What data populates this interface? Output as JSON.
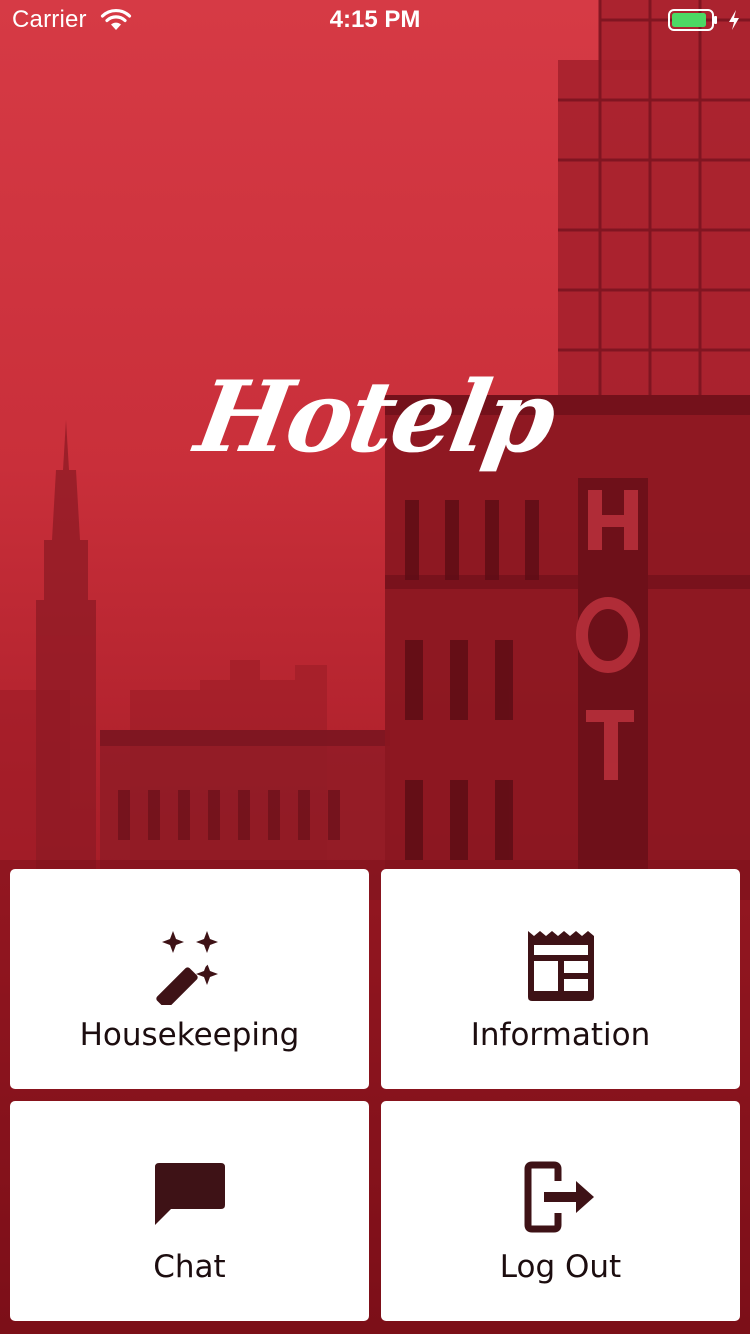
{
  "status_bar": {
    "carrier": "Carrier",
    "time": "4:15 PM",
    "wifi_icon": "wifi-icon",
    "battery_icon": "battery-charging-icon",
    "battery_level": 0.9
  },
  "app": {
    "logo_text": "Hotelp",
    "accent_color": "#c9313c",
    "icon_color": "#3e1216"
  },
  "tiles": [
    {
      "label": "Housekeeping",
      "icon": "magic-wand-icon"
    },
    {
      "label": "Information",
      "icon": "newspaper-icon"
    },
    {
      "label": "Chat",
      "icon": "chat-bubble-icon"
    },
    {
      "label": "Log Out",
      "icon": "logout-icon"
    }
  ]
}
